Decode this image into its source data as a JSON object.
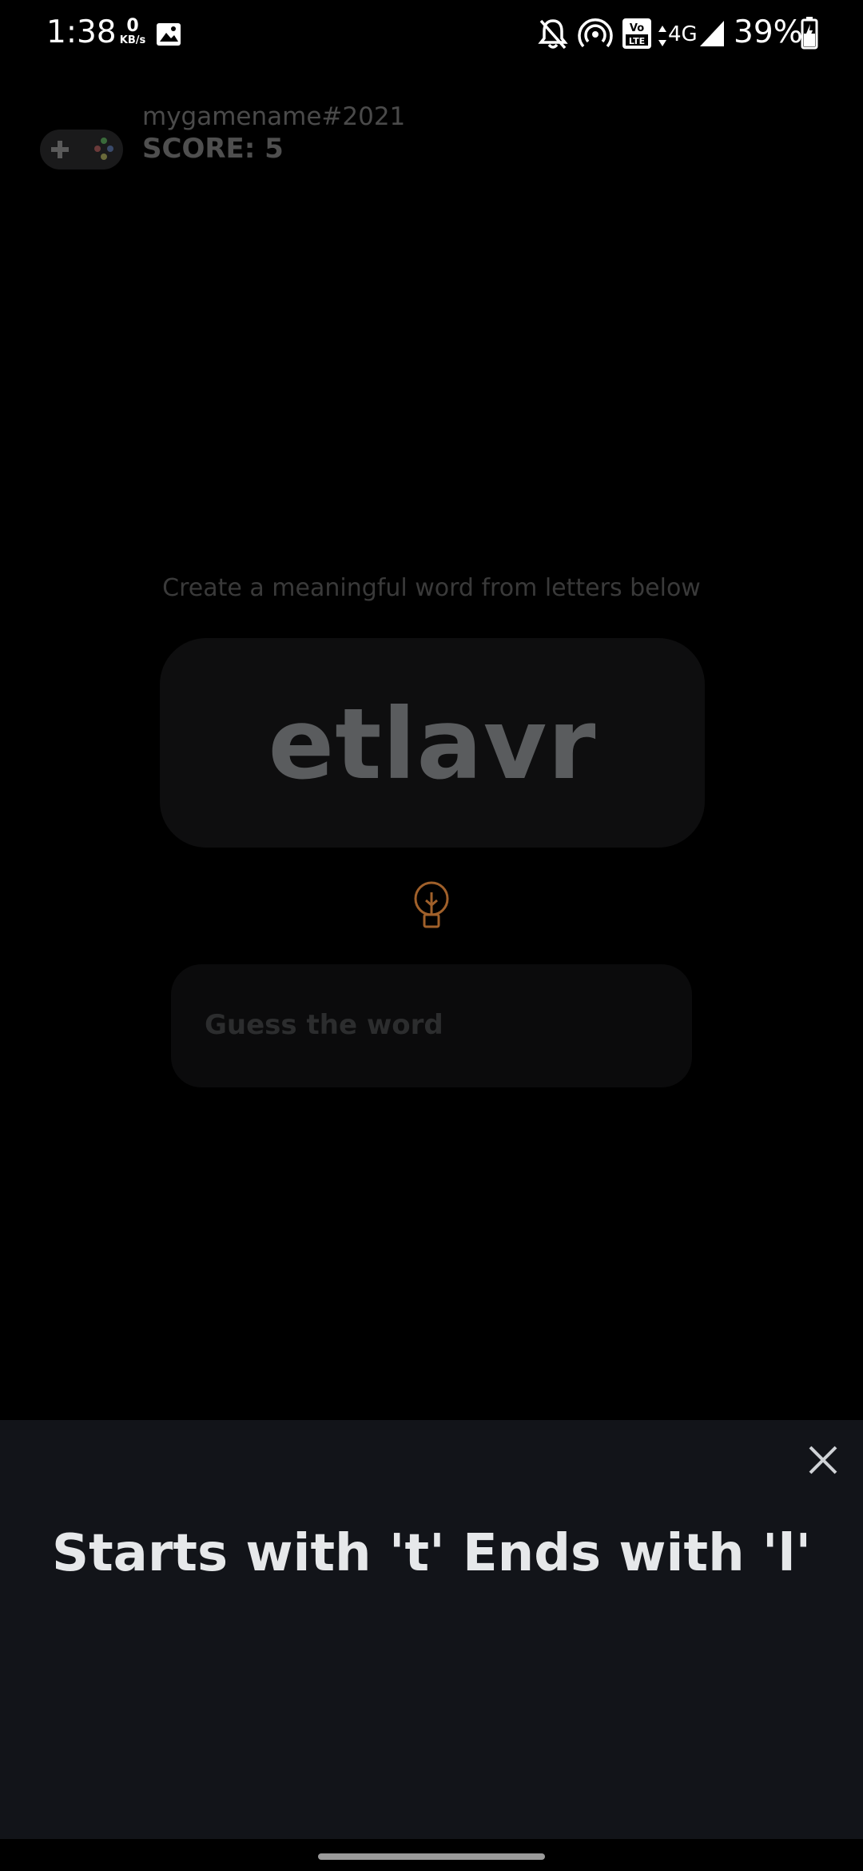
{
  "status_bar": {
    "time": "1:38",
    "net_speed_value": "0",
    "net_speed_unit": "KB/s",
    "network_type": "4G",
    "volte_label": "Vo LTE",
    "battery_percent": "39%"
  },
  "header": {
    "game_name": "mygamename#2021",
    "score": "SCORE: 5"
  },
  "main": {
    "instruction": "Create a meaningful word from letters below",
    "scrambled_letters": "etlavr",
    "guess_placeholder": "Guess the word"
  },
  "hint_sheet": {
    "hint_text": "Starts with 't' Ends with 'l'"
  },
  "colors": {
    "hint_icon": "#a0602a",
    "sheet_bg": "#121419"
  }
}
